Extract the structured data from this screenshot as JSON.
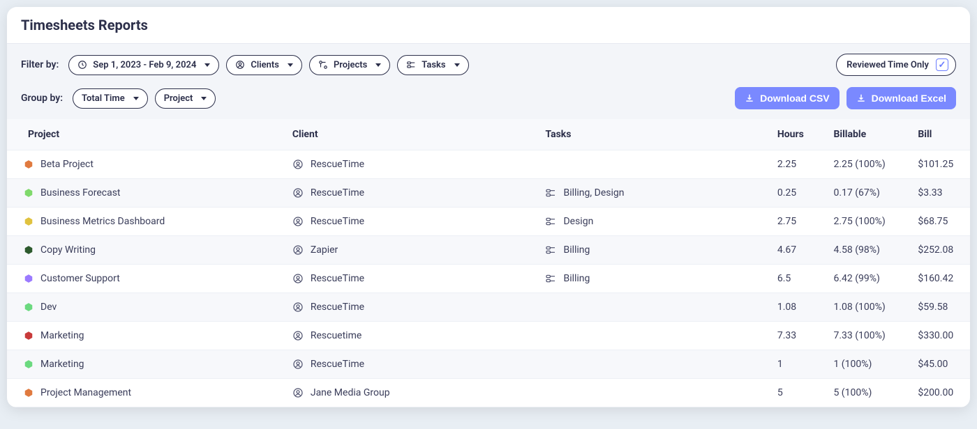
{
  "title": "Timesheets Reports",
  "filter_label": "Filter by:",
  "group_label": "Group by:",
  "date_range": "Sep 1, 2023 - Feb 9, 2024",
  "filter_clients": "Clients",
  "filter_projects": "Projects",
  "filter_tasks": "Tasks",
  "reviewed_label": "Reviewed Time Only",
  "group_total": "Total Time",
  "group_project": "Project",
  "download_csv": "Download CSV",
  "download_excel": "Download Excel",
  "columns": {
    "project": "Project",
    "client": "Client",
    "tasks": "Tasks",
    "hours": "Hours",
    "billable": "Billable",
    "bill": "Bill"
  },
  "rows": [
    {
      "color": "#e07a3f",
      "project": "Beta Project",
      "client": "RescueTime",
      "tasks": "",
      "hours": "2.25",
      "billable": "2.25 (100%)",
      "bill": "$101.25"
    },
    {
      "color": "#7fd96b",
      "project": "Business Forecast",
      "client": "RescueTime",
      "tasks": "Billing, Design",
      "hours": "0.25",
      "billable": "0.17 (67%)",
      "bill": "$3.33"
    },
    {
      "color": "#e0c23f",
      "project": "Business Metrics Dashboard",
      "client": "RescueTime",
      "tasks": "Design",
      "hours": "2.75",
      "billable": "2.75 (100%)",
      "bill": "$68.75"
    },
    {
      "color": "#2d5a2d",
      "project": "Copy Writing",
      "client": "Zapier",
      "tasks": "Billing",
      "hours": "4.67",
      "billable": "4.58 (98%)",
      "bill": "$252.08"
    },
    {
      "color": "#9b7aff",
      "project": "Customer Support",
      "client": "RescueTime",
      "tasks": "Billing",
      "hours": "6.5",
      "billable": "6.42 (99%)",
      "bill": "$160.42"
    },
    {
      "color": "#6bd97f",
      "project": "Dev",
      "client": "RescueTime",
      "tasks": "",
      "hours": "1.08",
      "billable": "1.08 (100%)",
      "bill": "$59.58"
    },
    {
      "color": "#c83a3a",
      "project": "Marketing",
      "client": "Rescuetime",
      "tasks": "",
      "hours": "7.33",
      "billable": "7.33 (100%)",
      "bill": "$330.00"
    },
    {
      "color": "#6bd97f",
      "project": "Marketing",
      "client": "RescueTime",
      "tasks": "",
      "hours": "1",
      "billable": "1 (100%)",
      "bill": "$45.00"
    },
    {
      "color": "#e07a3f",
      "project": "Project Management",
      "client": "Jane Media Group",
      "tasks": "",
      "hours": "5",
      "billable": "5 (100%)",
      "bill": "$200.00"
    }
  ]
}
